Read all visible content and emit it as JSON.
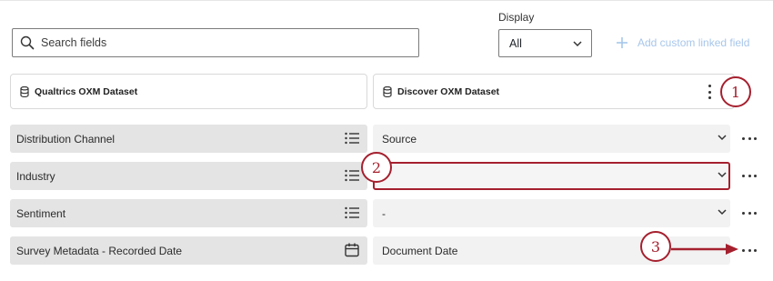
{
  "search": {
    "placeholder": "Search fields",
    "icon": "search-icon"
  },
  "display": {
    "label": "Display",
    "selected": "All",
    "icon": "chevron-down-icon"
  },
  "add_field": {
    "label": "Add custom linked field",
    "icon": "plus-icon",
    "color": "#a7c6ea"
  },
  "datasets": {
    "left": {
      "title": "Qualtrics OXM Dataset",
      "icon": "database-icon"
    },
    "right": {
      "title": "Discover OXM Dataset",
      "icon": "database-icon"
    }
  },
  "rows": [
    {
      "left": "Distribution Channel",
      "left_icon": "list-icon",
      "right": "Source"
    },
    {
      "left": "Industry",
      "left_icon": "list-icon",
      "right": ""
    },
    {
      "left": "Sentiment",
      "left_icon": "list-icon",
      "right": "-"
    },
    {
      "left": "Survey Metadata - Recorded Date",
      "left_icon": "calendar-icon",
      "right": "Document Date"
    }
  ],
  "callouts": [
    "1",
    "2",
    "3"
  ],
  "colors": {
    "callout": "#a5202e",
    "left_field_bg": "#e4e4e4",
    "right_field_bg": "#f2f2f2"
  }
}
